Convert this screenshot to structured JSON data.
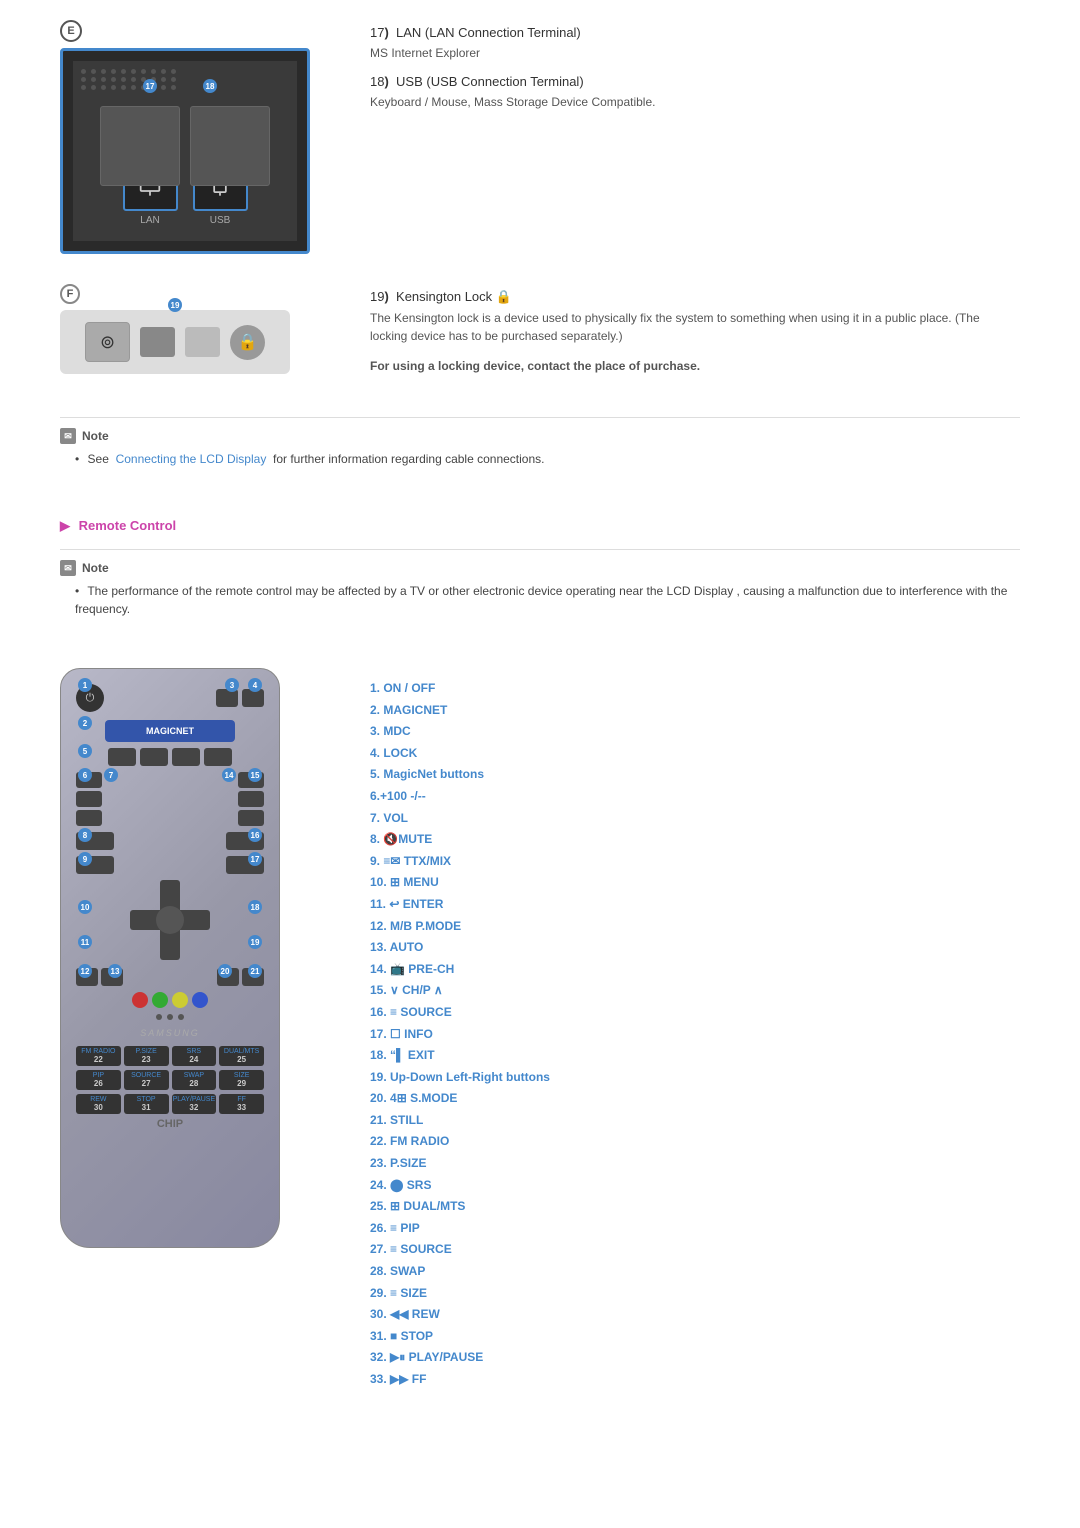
{
  "section17": {
    "number": "17",
    "title": "LAN (LAN Connection Terminal)",
    "description": "MS Internet Explorer"
  },
  "section18": {
    "number": "18",
    "title": "USB (USB Connection Terminal)",
    "description": "Keyboard / Mouse, Mass Storage Device Compatible."
  },
  "section19": {
    "number": "19",
    "title": "Kensington Lock",
    "description1": "The Kensington lock is a device used to physically fix the system to something when using it in a public place. (The locking device has to be purchased separately.)",
    "description2": "For using a locking device, contact the place of purchase."
  },
  "note1": {
    "label": "Note",
    "bullet": "See",
    "link": "Connecting the LCD Display",
    "rest": "for further information regarding cable connections."
  },
  "remoteControl": {
    "title": "Remote Control",
    "label": "Note",
    "noteText": "The performance of the remote control may be affected by a TV or other electronic device operating near the LCD Display , causing a malfunction due to interference with the frequency."
  },
  "buttons": [
    {
      "num": "1.",
      "text": "ON / OFF"
    },
    {
      "num": "2.",
      "text": "MAGICNET"
    },
    {
      "num": "3.",
      "text": "MDC"
    },
    {
      "num": "4.",
      "text": "LOCK"
    },
    {
      "num": "5.",
      "text": "MagicNet buttons"
    },
    {
      "num": "6.",
      "text": "+100 -/--"
    },
    {
      "num": "7.",
      "text": "VOL"
    },
    {
      "num": "8.",
      "text": "🔇 MUTE"
    },
    {
      "num": "9.",
      "text": "≡✉ TTX/MIX"
    },
    {
      "num": "10.",
      "text": "⊞ MENU"
    },
    {
      "num": "11.",
      "text": "↩ ENTER"
    },
    {
      "num": "12.",
      "text": "M/B P.MODE"
    },
    {
      "num": "13.",
      "text": "AUTO"
    },
    {
      "num": "14.",
      "text": "📺 PRE-CH"
    },
    {
      "num": "15.",
      "text": "∨ CH/P ∧"
    },
    {
      "num": "16.",
      "text": "≡ SOURCE"
    },
    {
      "num": "17.",
      "text": "☐ INFO"
    },
    {
      "num": "18.",
      "text": "\" ▌EXIT"
    },
    {
      "num": "19.",
      "text": "Up-Down Left-Right buttons"
    },
    {
      "num": "20.",
      "text": "4⊞ S.MODE"
    },
    {
      "num": "21.",
      "text": "STILL"
    },
    {
      "num": "22.",
      "text": "FM RADIO"
    },
    {
      "num": "23.",
      "text": "P.SIZE"
    },
    {
      "num": "24.",
      "text": "⬤ SRS"
    },
    {
      "num": "25.",
      "text": "⊞ DUAL/MTS"
    },
    {
      "num": "26.",
      "text": "≡ PIP"
    },
    {
      "num": "27.",
      "text": "≡ SOURCE"
    },
    {
      "num": "28.",
      "text": "SWAP"
    },
    {
      "num": "29.",
      "text": "≡ SIZE"
    },
    {
      "num": "30.",
      "text": "◀◀ REW"
    },
    {
      "num": "31.",
      "text": "■ STOP"
    },
    {
      "num": "32.",
      "text": "▶⏸ PLAY/PAUSE"
    },
    {
      "num": "33.",
      "text": "▶▶ FF"
    }
  ],
  "panelRows": {
    "row1": {
      "labels": [
        "FM RADIO",
        "P.SIZE",
        "SRS",
        "DUAL/MTS"
      ],
      "nums": [
        "22",
        "23",
        "24",
        "25"
      ]
    },
    "row2": {
      "labels": [
        "PIP",
        "SOURCE",
        "SWAP",
        "SIZE"
      ],
      "nums": [
        "26",
        "27",
        "28",
        "29"
      ]
    },
    "row3": {
      "labels": [
        "REW",
        "STOP",
        "PLAY/PAUSE",
        "FF"
      ],
      "nums": [
        "30",
        "31",
        "32",
        "33"
      ]
    }
  },
  "circleE": "E",
  "circleF": "F",
  "chipLabel": "CHIP"
}
